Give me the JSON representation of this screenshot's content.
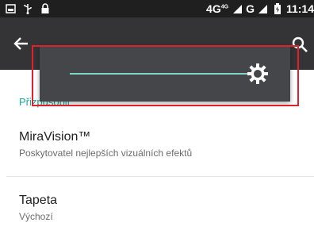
{
  "status_bar": {
    "network_text": "4G",
    "network_sup": "4G",
    "carrier_letter": "G",
    "time": "11:14"
  },
  "toolbar": {
    "back_icon": "arrow-left-icon",
    "search_icon": "search-icon"
  },
  "brightness": {
    "level": 0.9,
    "track_color": "#7fd3c6",
    "icon": "brightness-icon"
  },
  "section": {
    "header": "Přizpůsobit"
  },
  "items": [
    {
      "title": "MiraVision™",
      "subtitle": "Poskytovatel nejlepších vizuálních efektů"
    },
    {
      "title": "Tapeta",
      "subtitle": "Výchozí"
    }
  ],
  "colors": {
    "accent": "#19a99a",
    "toolbar": "#343436",
    "highlight": "#e0202a"
  }
}
